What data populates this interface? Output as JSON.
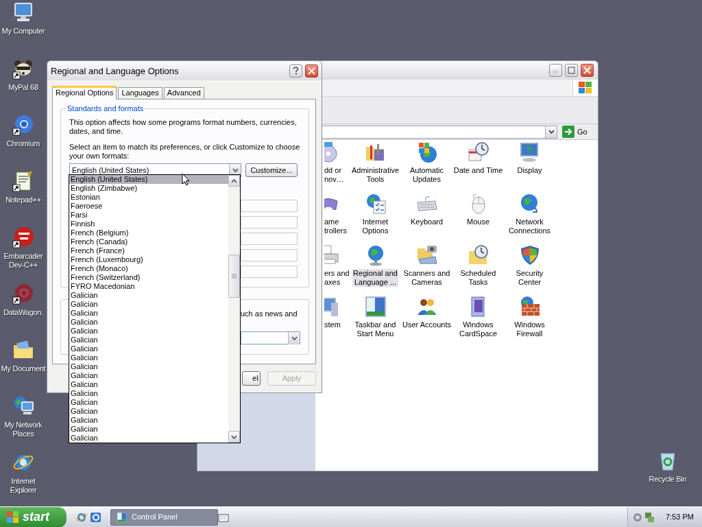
{
  "desktop_icons": [
    {
      "label": "My Computer"
    },
    {
      "label": "MyPal 68"
    },
    {
      "label": "Chromium"
    },
    {
      "label": "Notepad++"
    },
    {
      "label": "Embarcader\nDev-C++"
    },
    {
      "label": "DataWagon."
    },
    {
      "label": "My Document"
    },
    {
      "label": "My Network\nPlaces"
    },
    {
      "label": "Internet\nExplorer"
    }
  ],
  "recycle_bin": {
    "label": "Recycle Bin"
  },
  "control_panel": {
    "go": "Go",
    "items": [
      {
        "label": "dd or\nnov…",
        "selected": false
      },
      {
        "label": "Administrative\nTools",
        "selected": false
      },
      {
        "label": "Automatic\nUpdates",
        "selected": false
      },
      {
        "label": "Date and Time",
        "selected": false
      },
      {
        "label": "Display",
        "selected": false
      },
      {
        "label": "ame\ntrollers",
        "selected": false
      },
      {
        "label": "Internet\nOptions",
        "selected": false
      },
      {
        "label": "Keyboard",
        "selected": false
      },
      {
        "label": "Mouse",
        "selected": false
      },
      {
        "label": "Network\nConnections",
        "selected": false
      },
      {
        "label": "ers and\naxes",
        "selected": false
      },
      {
        "label": "Regional and\nLanguage ...",
        "selected": true
      },
      {
        "label": "Scanners and\nCameras",
        "selected": false
      },
      {
        "label": "Scheduled\nTasks",
        "selected": false
      },
      {
        "label": "Security\nCenter",
        "selected": false
      },
      {
        "label": "stem",
        "selected": false
      },
      {
        "label": "Taskbar and\nStart Menu",
        "selected": false
      },
      {
        "label": "User Accounts",
        "selected": false
      },
      {
        "label": "Windows\nCardSpace",
        "selected": false
      },
      {
        "label": "Windows\nFirewall",
        "selected": false
      }
    ]
  },
  "dialog": {
    "title": "Regional and Language Options",
    "tabs": [
      {
        "label": "Regional Options",
        "selected": true
      },
      {
        "label": "Languages",
        "selected": false
      },
      {
        "label": "Advanced",
        "selected": false
      }
    ],
    "group_title": "Standards and formats",
    "description": "This option affects how some programs format numbers, currencies, dates, and time.",
    "instruction": "Select an item to match its preferences, or click Customize to choose your own formats:",
    "format_value": "English (United States)",
    "customize": "Customize...",
    "group2_text": "uch as news and",
    "buttons": [
      {
        "label": "el",
        "disabled": false
      },
      {
        "label": "Apply",
        "disabled": true
      }
    ],
    "dropdown_items": [
      {
        "label": "English (United States)",
        "selected": true
      },
      {
        "label": "English (Zimbabwe)",
        "selected": false
      },
      {
        "label": "Estonian",
        "selected": false
      },
      {
        "label": "Faeroese",
        "selected": false
      },
      {
        "label": "Farsi",
        "selected": false
      },
      {
        "label": "Finnish",
        "selected": false
      },
      {
        "label": "French (Belgium)",
        "selected": false
      },
      {
        "label": "French (Canada)",
        "selected": false
      },
      {
        "label": "French (France)",
        "selected": false
      },
      {
        "label": "French (Luxembourg)",
        "selected": false
      },
      {
        "label": "French (Monaco)",
        "selected": false
      },
      {
        "label": "French (Switzerland)",
        "selected": false
      },
      {
        "label": "FYRO Macedonian",
        "selected": false
      },
      {
        "label": "Galician",
        "selected": false
      },
      {
        "label": "Galician",
        "selected": false
      },
      {
        "label": "Galician",
        "selected": false
      },
      {
        "label": "Galician",
        "selected": false
      },
      {
        "label": "Galician",
        "selected": false
      },
      {
        "label": "Galician",
        "selected": false
      },
      {
        "label": "Galician",
        "selected": false
      },
      {
        "label": "Galician",
        "selected": false
      },
      {
        "label": "Galician",
        "selected": false
      },
      {
        "label": "Galician",
        "selected": false
      },
      {
        "label": "Galician",
        "selected": false
      },
      {
        "label": "Galician",
        "selected": false
      },
      {
        "label": "Galician",
        "selected": false
      },
      {
        "label": "Galician",
        "selected": false
      },
      {
        "label": "Galician",
        "selected": false
      },
      {
        "label": "Galician",
        "selected": false
      },
      {
        "label": "Galician",
        "selected": false
      }
    ]
  },
  "taskbar": {
    "start": "start",
    "tasks": [
      {
        "label": "Control Panel",
        "selected": true
      }
    ],
    "clock": "7:53 PM"
  }
}
